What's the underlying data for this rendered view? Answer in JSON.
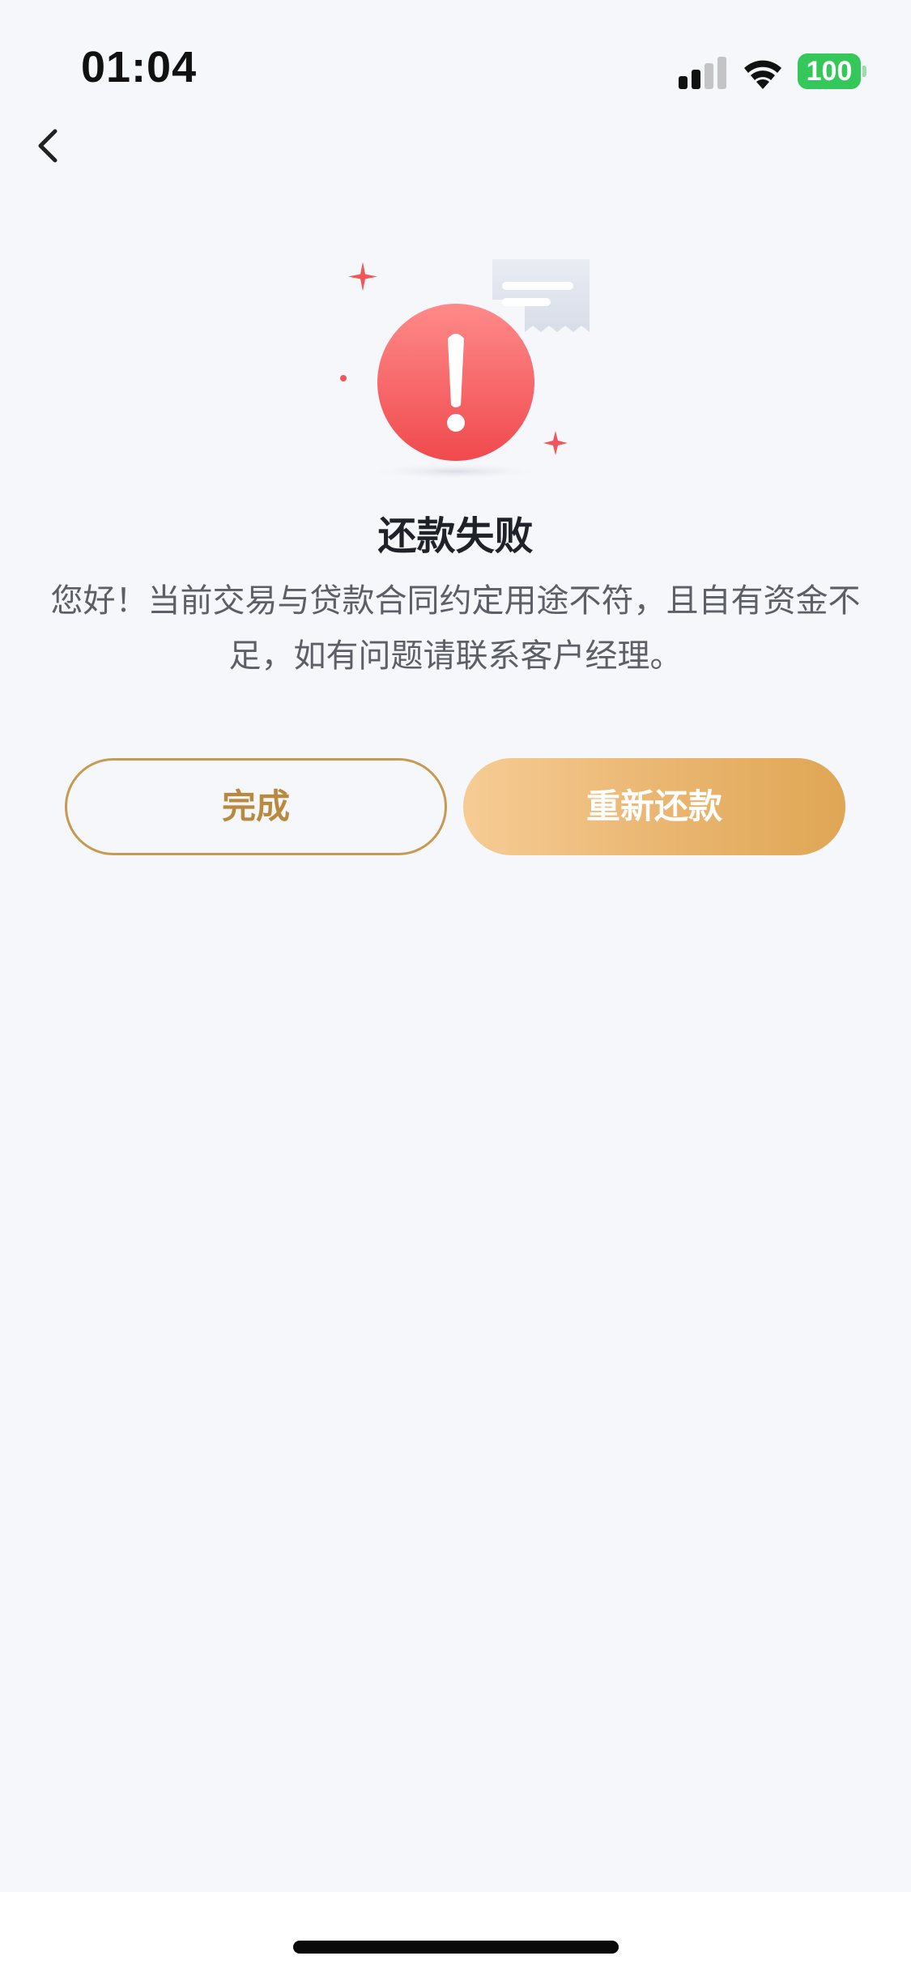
{
  "status_bar": {
    "time": "01:04",
    "battery": "100",
    "battery_color": "#34c759",
    "signal_icon": "cellular-signal-icon",
    "wifi_icon": "wifi-icon"
  },
  "nav": {
    "back_icon": "chevron-left-icon"
  },
  "result": {
    "icon": "error-exclamation-icon",
    "title": "还款失败",
    "message": "您好！当前交易与贷款合同约定用途不符，且自有资金不足，如有问题请联系客户经理。",
    "accent_color": "#f25a5a"
  },
  "actions": {
    "done_label": "完成",
    "retry_label": "重新还款",
    "brand_color": "#c79a52"
  }
}
